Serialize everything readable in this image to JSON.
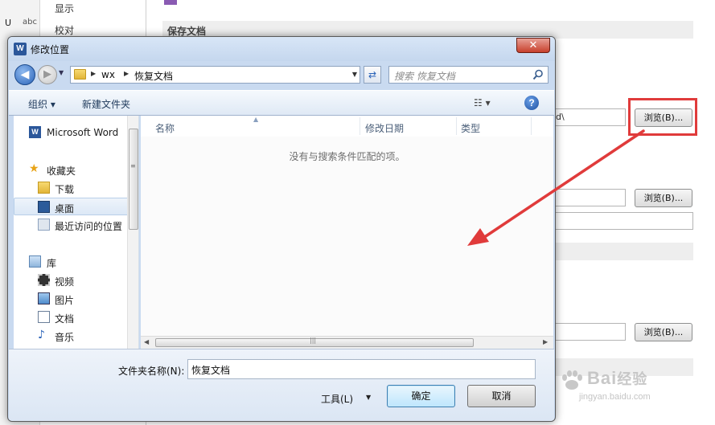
{
  "background": {
    "nav_items": [
      "显示",
      "校对"
    ],
    "left_strip": {
      "underline": "U",
      "abc": "abc"
    },
    "section_save": "保存文档",
    "path_fragment": "d\\",
    "browse_label": "浏览(B)..."
  },
  "dialog": {
    "title": "修改位置",
    "close_label": "✕",
    "address": {
      "segments": [
        "wx",
        "恢复文档"
      ],
      "search_placeholder": "搜索 恢复文档"
    },
    "toolbar": {
      "organize": "组织 ▾",
      "new_folder": "新建文件夹",
      "help": "?"
    },
    "nav": {
      "app": "Microsoft Word",
      "favorites": "收藏夹",
      "favorites_items": [
        "下载",
        "桌面",
        "最近访问的位置"
      ],
      "libraries": "库",
      "library_items": [
        "视频",
        "图片",
        "文档",
        "音乐"
      ]
    },
    "columns": [
      "名称",
      "修改日期",
      "类型"
    ],
    "empty_message": "没有与搜索条件匹配的项。",
    "folder_name_label": "文件夹名称(N):",
    "folder_name_value": "恢复文档",
    "tools_label": "工具(L)",
    "ok_label": "确定",
    "cancel_label": "取消"
  },
  "annotation": {
    "color": "#e03b3b"
  },
  "watermark": {
    "brand": "Bai",
    "brand_cn": "经验",
    "url": "jingyan.baidu.com"
  }
}
